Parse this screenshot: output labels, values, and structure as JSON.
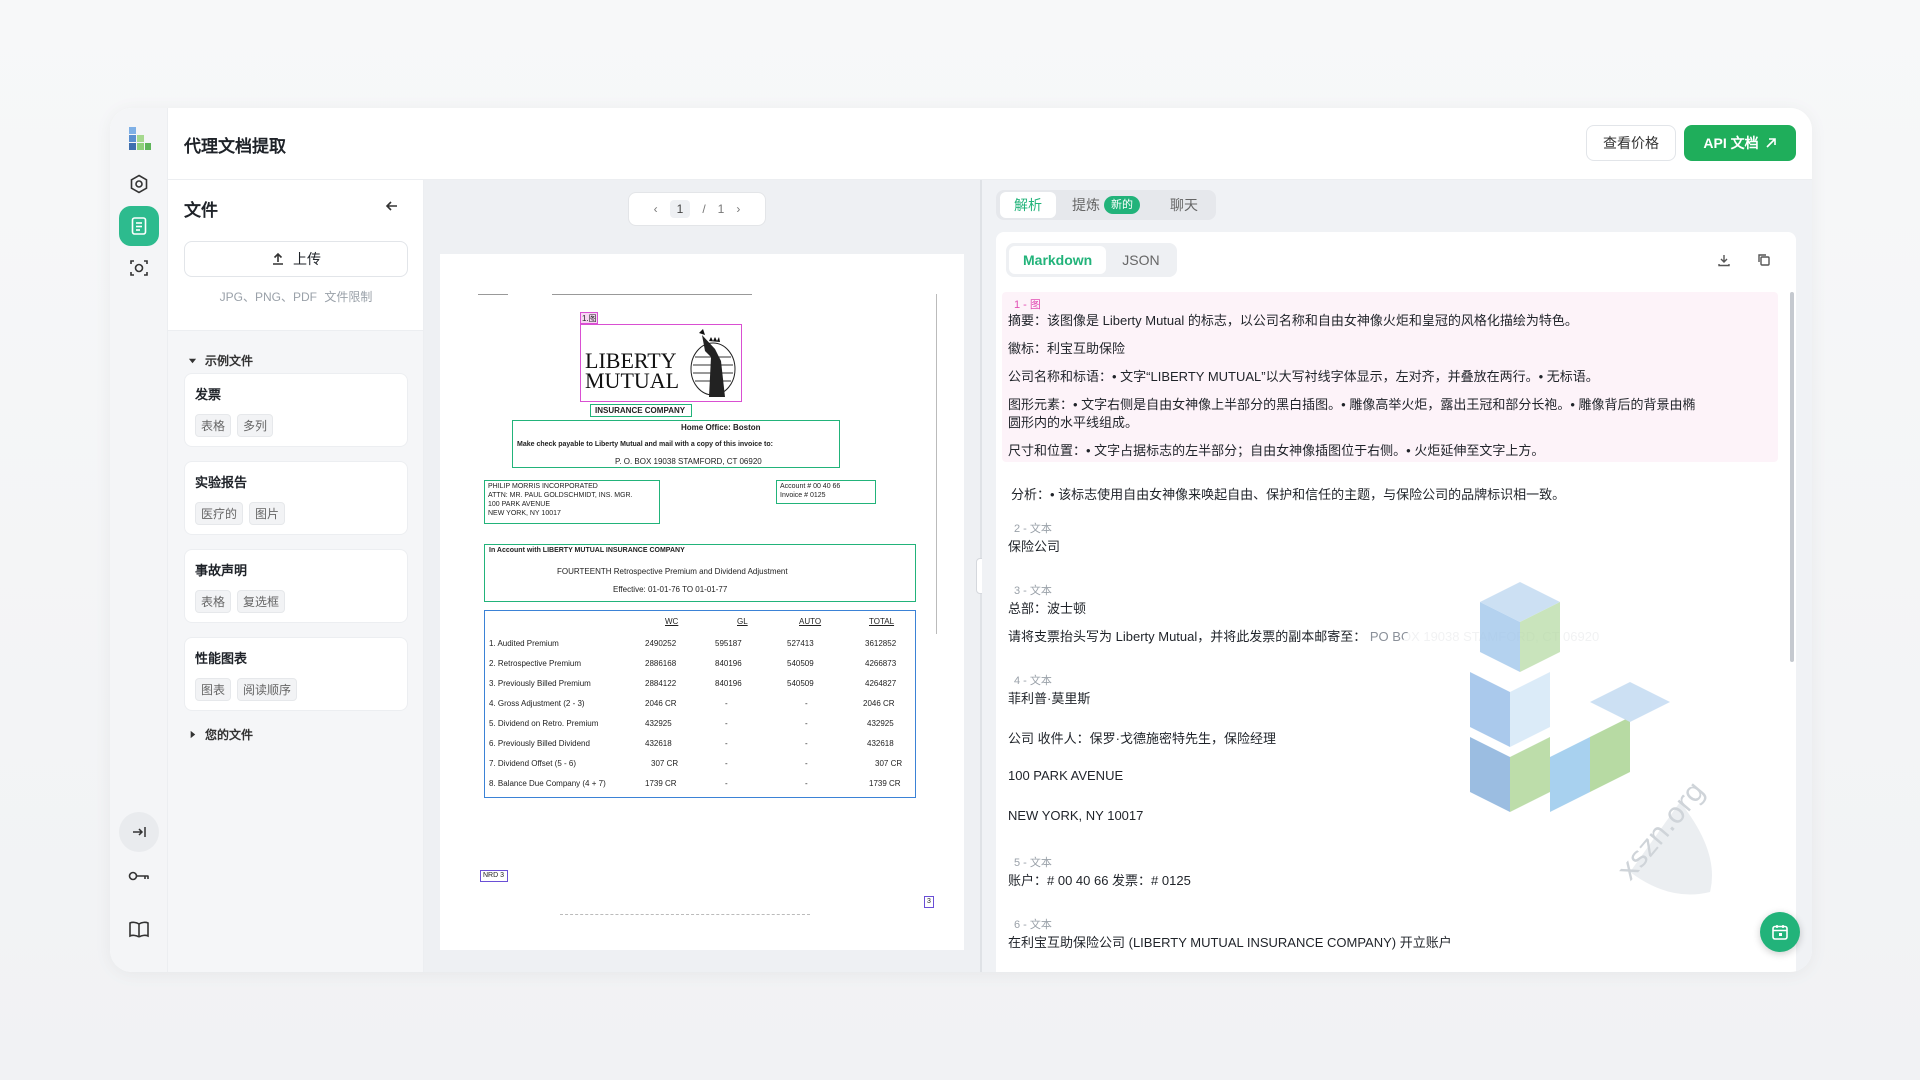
{
  "header": {
    "title": "代理文档提取",
    "price_button": "查看价格",
    "api_button": "API 文档"
  },
  "files": {
    "title": "文件",
    "upload_label": "上传",
    "limit_formats": "JPG、PNG、PDF",
    "limit_link": "文件限制",
    "examples_header": "示例文件",
    "your_files_header": "您的文件",
    "cards": [
      {
        "title": "发票",
        "tags": [
          "表格",
          "多列"
        ]
      },
      {
        "title": "实验报告",
        "tags": [
          "医疗的",
          "图片"
        ]
      },
      {
        "title": "事故声明",
        "tags": [
          "表格",
          "复选框"
        ]
      },
      {
        "title": "性能图表",
        "tags": [
          "图表",
          "阅读顺序"
        ]
      }
    ]
  },
  "viewer": {
    "page_current": "1",
    "page_sep": "/",
    "page_total": "1",
    "doc": {
      "tag_logo": "1.图",
      "logo_line1": "LIBERTY",
      "logo_line2": "MUTUAL",
      "company": "INSURANCE COMPANY",
      "home_office": "Home Office: Boston",
      "check_line": "Make check payable to Liberty Mutual and mail with a copy of this invoice to:",
      "po_box": "P. O. BOX 19038 STAMFORD, CT 06920",
      "addr1": "PHILIP MORRIS INCORPORATED",
      "addr2": "ATTN: MR. PAUL GOLDSCHMIDT, INS. MGR.",
      "addr3": "100 PARK AVENUE",
      "addr4": "NEW YORK, NY 10017",
      "acct1": "Account   # 00 40 66",
      "acct2": "Invoice     # 0125",
      "in_account": "In Account with LIBERTY MUTUAL INSURANCE COMPANY",
      "fourteenth": "FOURTEENTH Retrospective Premium and Dividend Adjustment",
      "effective": "Effective:    01-01-76  TO  01-01-77",
      "table_headers": [
        "WC",
        "GL",
        "AUTO",
        "TOTAL"
      ],
      "table_rows": [
        [
          "1. Audited Premium",
          "2490252",
          "595187",
          "527413",
          "3612852"
        ],
        [
          "2. Retrospective Premium",
          "2886168",
          "840196",
          "540509",
          "4266873"
        ],
        [
          "3. Previously Billed Premium",
          "2884122",
          "840196",
          "540509",
          "4264827"
        ],
        [
          "4. Gross Adjustment (2 - 3)",
          "2046 CR",
          "-",
          "-",
          "2046 CR"
        ],
        [
          "5. Dividend on Retro. Premium",
          "432925",
          "-",
          "-",
          "432925"
        ],
        [
          "6. Previously Billed Dividend",
          "432618",
          "-",
          "-",
          "432618"
        ],
        [
          "7. Dividend Offset (5 - 6)",
          "307 CR",
          "-",
          "-",
          "307 CR"
        ],
        [
          "8. Balance Due Company (4 + 7)",
          "1739 CR",
          "-",
          "-",
          "1739 CR"
        ]
      ],
      "nrd": "NRD 3",
      "corner": "3"
    }
  },
  "right": {
    "tabs": [
      "解析",
      "提炼",
      "聊天"
    ],
    "new_badge": "新的",
    "formats": [
      "Markdown",
      "JSON"
    ],
    "blocks": {
      "b1_label": "1 - 图",
      "b1_l1": "摘要：该图像是 Liberty Mutual 的标志，以公司名称和自由女神像火炬和皇冠的风格化描绘为特色。",
      "b1_l2": "徽标：利宝互助保险",
      "b1_l3": "公司名称和标语：• 文字“LIBERTY MUTUAL”以大写衬线字体显示，左对齐，并叠放在两行。• 无标语。",
      "b1_l4": "图形元素：• 文字右侧是自由女神像上半部分的黑白插图。• 雕像高举火炬，露出王冠和部分长袍。• 雕像背后的背景由椭",
      "b1_l5": "圆形内的水平线组成。",
      "b1_l6": "尺寸和位置：• 文字占据标志的左半部分；自由女神像插图位于右侧。• 火炬延伸至文字上方。",
      "b1_l7": "分析：• 该标志使用自由女神像来唤起自由、保护和信任的主题，与保险公司的品牌标识相一致。",
      "b2_label": "2 - 文本",
      "b2_l1": "保险公司",
      "b3_label": "3 - 文本",
      "b3_l1": "总部：波士顿",
      "b3_l2": "请将支票抬头写为 Liberty Mutual，并将此发票的副本邮寄至：",
      "b3_l2b": "PO BOX 19038 STAMFORD, CT 06920",
      "b4_label": "4 - 文本",
      "b4_l1": "菲利普·莫里斯",
      "b4_l2": "公司 收件人：保罗·戈德施密特先生，保险经理",
      "b4_l3": "100 PARK AVENUE",
      "b4_l4": "NEW YORK, NY 10017",
      "b5_label": "5 - 文本",
      "b5_l1": "账户：# 00 40 66 发票：# 0125",
      "b6_label": "6 - 文本",
      "b6_l1": "在利宝互助保险公司 (LIBERTY MUTUAL INSURANCE COMPANY) 开立账户"
    }
  },
  "watermark_text": "xszn.org",
  "colors": {
    "accent": "#22b37a",
    "api": "#1fae5b",
    "figure_box": "#d94fd2",
    "table_box": "#3b82d6"
  }
}
